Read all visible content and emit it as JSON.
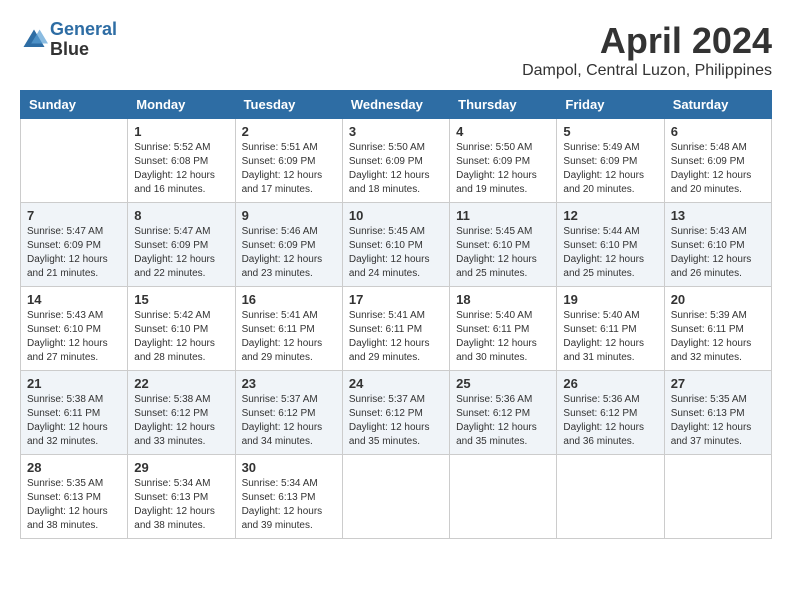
{
  "header": {
    "logo_line1": "General",
    "logo_line2": "Blue",
    "month": "April 2024",
    "location": "Dampol, Central Luzon, Philippines"
  },
  "weekdays": [
    "Sunday",
    "Monday",
    "Tuesday",
    "Wednesday",
    "Thursday",
    "Friday",
    "Saturday"
  ],
  "weeks": [
    [
      null,
      {
        "day": 1,
        "sunrise": "5:52 AM",
        "sunset": "6:08 PM",
        "daylight": "12 hours and 16 minutes."
      },
      {
        "day": 2,
        "sunrise": "5:51 AM",
        "sunset": "6:09 PM",
        "daylight": "12 hours and 17 minutes."
      },
      {
        "day": 3,
        "sunrise": "5:50 AM",
        "sunset": "6:09 PM",
        "daylight": "12 hours and 18 minutes."
      },
      {
        "day": 4,
        "sunrise": "5:50 AM",
        "sunset": "6:09 PM",
        "daylight": "12 hours and 19 minutes."
      },
      {
        "day": 5,
        "sunrise": "5:49 AM",
        "sunset": "6:09 PM",
        "daylight": "12 hours and 20 minutes."
      },
      {
        "day": 6,
        "sunrise": "5:48 AM",
        "sunset": "6:09 PM",
        "daylight": "12 hours and 20 minutes."
      }
    ],
    [
      {
        "day": 7,
        "sunrise": "5:47 AM",
        "sunset": "6:09 PM",
        "daylight": "12 hours and 21 minutes."
      },
      {
        "day": 8,
        "sunrise": "5:47 AM",
        "sunset": "6:09 PM",
        "daylight": "12 hours and 22 minutes."
      },
      {
        "day": 9,
        "sunrise": "5:46 AM",
        "sunset": "6:09 PM",
        "daylight": "12 hours and 23 minutes."
      },
      {
        "day": 10,
        "sunrise": "5:45 AM",
        "sunset": "6:10 PM",
        "daylight": "12 hours and 24 minutes."
      },
      {
        "day": 11,
        "sunrise": "5:45 AM",
        "sunset": "6:10 PM",
        "daylight": "12 hours and 25 minutes."
      },
      {
        "day": 12,
        "sunrise": "5:44 AM",
        "sunset": "6:10 PM",
        "daylight": "12 hours and 25 minutes."
      },
      {
        "day": 13,
        "sunrise": "5:43 AM",
        "sunset": "6:10 PM",
        "daylight": "12 hours and 26 minutes."
      }
    ],
    [
      {
        "day": 14,
        "sunrise": "5:43 AM",
        "sunset": "6:10 PM",
        "daylight": "12 hours and 27 minutes."
      },
      {
        "day": 15,
        "sunrise": "5:42 AM",
        "sunset": "6:10 PM",
        "daylight": "12 hours and 28 minutes."
      },
      {
        "day": 16,
        "sunrise": "5:41 AM",
        "sunset": "6:11 PM",
        "daylight": "12 hours and 29 minutes."
      },
      {
        "day": 17,
        "sunrise": "5:41 AM",
        "sunset": "6:11 PM",
        "daylight": "12 hours and 29 minutes."
      },
      {
        "day": 18,
        "sunrise": "5:40 AM",
        "sunset": "6:11 PM",
        "daylight": "12 hours and 30 minutes."
      },
      {
        "day": 19,
        "sunrise": "5:40 AM",
        "sunset": "6:11 PM",
        "daylight": "12 hours and 31 minutes."
      },
      {
        "day": 20,
        "sunrise": "5:39 AM",
        "sunset": "6:11 PM",
        "daylight": "12 hours and 32 minutes."
      }
    ],
    [
      {
        "day": 21,
        "sunrise": "5:38 AM",
        "sunset": "6:11 PM",
        "daylight": "12 hours and 32 minutes."
      },
      {
        "day": 22,
        "sunrise": "5:38 AM",
        "sunset": "6:12 PM",
        "daylight": "12 hours and 33 minutes."
      },
      {
        "day": 23,
        "sunrise": "5:37 AM",
        "sunset": "6:12 PM",
        "daylight": "12 hours and 34 minutes."
      },
      {
        "day": 24,
        "sunrise": "5:37 AM",
        "sunset": "6:12 PM",
        "daylight": "12 hours and 35 minutes."
      },
      {
        "day": 25,
        "sunrise": "5:36 AM",
        "sunset": "6:12 PM",
        "daylight": "12 hours and 35 minutes."
      },
      {
        "day": 26,
        "sunrise": "5:36 AM",
        "sunset": "6:12 PM",
        "daylight": "12 hours and 36 minutes."
      },
      {
        "day": 27,
        "sunrise": "5:35 AM",
        "sunset": "6:13 PM",
        "daylight": "12 hours and 37 minutes."
      }
    ],
    [
      {
        "day": 28,
        "sunrise": "5:35 AM",
        "sunset": "6:13 PM",
        "daylight": "12 hours and 38 minutes."
      },
      {
        "day": 29,
        "sunrise": "5:34 AM",
        "sunset": "6:13 PM",
        "daylight": "12 hours and 38 minutes."
      },
      {
        "day": 30,
        "sunrise": "5:34 AM",
        "sunset": "6:13 PM",
        "daylight": "12 hours and 39 minutes."
      },
      null,
      null,
      null,
      null
    ]
  ]
}
